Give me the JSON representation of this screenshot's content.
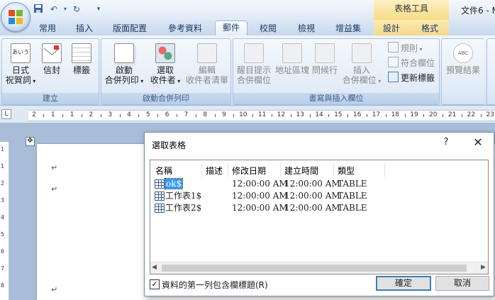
{
  "window": {
    "contextual_tools": "表格工具",
    "doc_title": "文件6 - M"
  },
  "tabs": [
    {
      "label": "常用"
    },
    {
      "label": "插入"
    },
    {
      "label": "版面配置"
    },
    {
      "label": "參考資料"
    },
    {
      "label": "郵件",
      "active": true
    },
    {
      "label": "校閱"
    },
    {
      "label": "檢視"
    },
    {
      "label": "增益集"
    },
    {
      "label": "設計"
    },
    {
      "label": "格式"
    }
  ],
  "ribbon": {
    "create": {
      "label": "建立",
      "buttons": [
        {
          "line1": "日式",
          "line2": "祝賀詞",
          "icon": "envelope-japanese-icon"
        },
        {
          "line1": "信封",
          "line2": "",
          "icon": "envelope-icon"
        },
        {
          "line1": "標籤",
          "line2": "",
          "icon": "labels-icon"
        }
      ]
    },
    "start_merge": {
      "label": "啟動合併列印",
      "buttons": [
        {
          "line1": "啟動",
          "line2": "合併列印",
          "icon": "start-merge-icon"
        },
        {
          "line1": "選取",
          "line2": "收件者",
          "icon": "select-recipients-icon"
        },
        {
          "line1": "編輯",
          "line2": "收件者清單",
          "icon": "edit-recipients-icon"
        }
      ]
    },
    "write_insert": {
      "label": "書寫與插入欄位",
      "buttons": [
        {
          "line1": "醒目提示",
          "line2": "合併欄位"
        },
        {
          "line1": "地址區塊",
          "line2": ""
        },
        {
          "line1": "問候行",
          "line2": ""
        },
        {
          "line1": "插入",
          "line2": "合併欄位"
        }
      ],
      "small": [
        {
          "label": "規則"
        },
        {
          "label": "符合欄位"
        },
        {
          "label": "更新標籤"
        }
      ]
    },
    "preview": {
      "label": "預覽結果",
      "icon_text": "ABC"
    }
  },
  "ruler": {
    "corner": "L",
    "numbers": [
      "2",
      "1",
      "1",
      "2",
      "3",
      "4",
      "5",
      "6",
      "7",
      "8",
      "9",
      "10",
      "11",
      "12",
      "13",
      "14",
      "15",
      "16",
      "17",
      "18",
      "19",
      "20",
      "21",
      "22",
      "23"
    ],
    "vertical": [
      "1",
      "1",
      "2",
      "3",
      "4",
      "5",
      "6",
      "7",
      "8"
    ]
  },
  "document": {
    "move_handle": "✥",
    "para_mark": "↵"
  },
  "dialog": {
    "title": "選取表格",
    "help": "?",
    "close": "✕",
    "columns": [
      "名稱",
      "描述",
      "修改日期",
      "建立時間",
      "類型"
    ],
    "rows": [
      {
        "name": "ok$",
        "description": "",
        "modified": "12:00:00 AM",
        "created": "12:00:00 AM",
        "type": "TABLE",
        "selected": true
      },
      {
        "name": "工作表1$",
        "description": "",
        "modified": "12:00:00 AM",
        "created": "12:00:00 AM",
        "type": "TABLE"
      },
      {
        "name": "工作表2$",
        "description": "",
        "modified": "12:00:00 AM",
        "created": "12:00:00 AM",
        "type": "TABLE"
      }
    ],
    "scroll_left": "◀",
    "scroll_right": "▶",
    "checkbox_checked": true,
    "checkbox_mark": "✓",
    "checkbox_label": "資料的第一列包含欄標題(R)",
    "ok_label": "確定",
    "cancel_label": "取消"
  }
}
